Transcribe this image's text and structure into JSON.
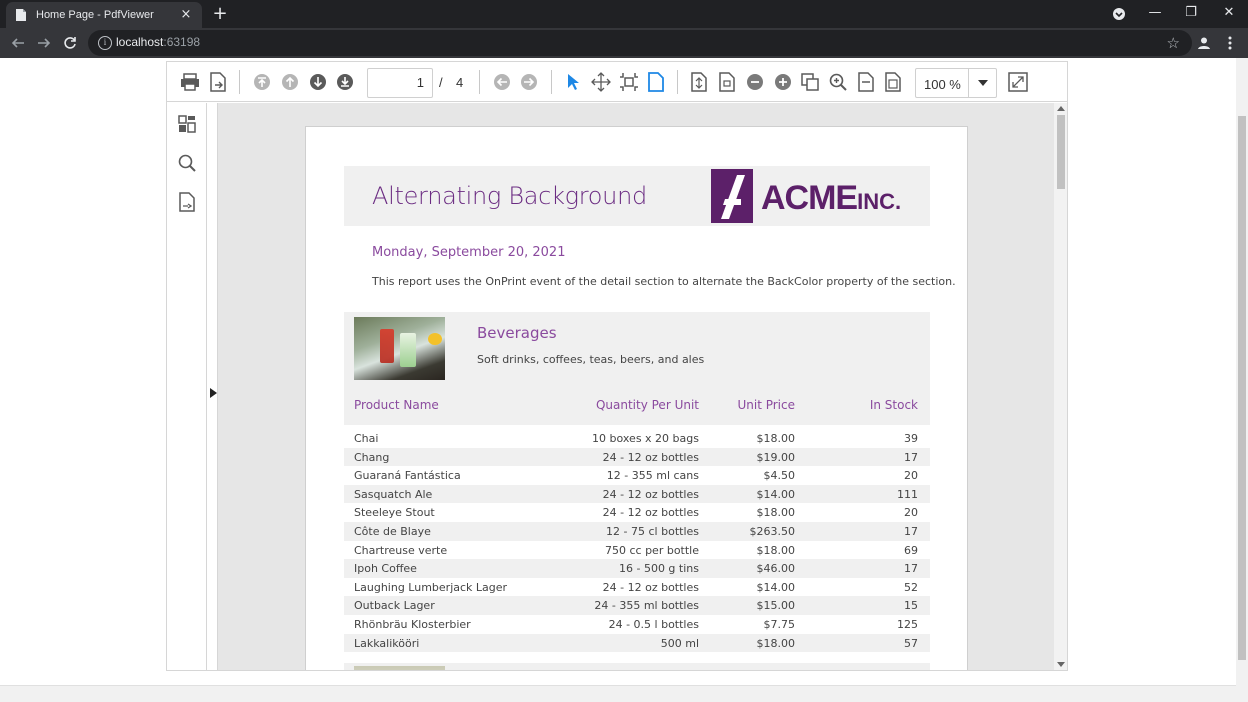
{
  "browser": {
    "tab_title": "Home Page - PdfViewer",
    "tab_close": "×",
    "new_tab": "+",
    "url_host": "localhost",
    "url_port": ":63198",
    "win_minimize": "—",
    "win_restore": "❐",
    "win_close": "✕"
  },
  "toolbar": {
    "page_current": "1",
    "page_separator": "/",
    "page_total": "4",
    "zoom_value": "100 %"
  },
  "report": {
    "title": "Alternating Background",
    "logo_text": "ACME",
    "logo_suffix": "INC.",
    "date": "Monday, September 20, 2021",
    "description": "This report uses the OnPrint event of the detail section to alternate the BackColor property of the section."
  },
  "category": {
    "name": "Beverages",
    "description": "Soft drinks, coffees, teas, beers, and ales",
    "columns": {
      "product": "Product Name",
      "quantity": "Quantity Per Unit",
      "price": "Unit Price",
      "stock": "In Stock"
    },
    "products": [
      {
        "name": "Chai",
        "qty": "10 boxes x 20 bags",
        "price": "$18.00",
        "stock": "39"
      },
      {
        "name": "Chang",
        "qty": "24 - 12 oz bottles",
        "price": "$19.00",
        "stock": "17"
      },
      {
        "name": "Guaraná Fantástica",
        "qty": "12 - 355 ml cans",
        "price": "$4.50",
        "stock": "20"
      },
      {
        "name": "Sasquatch Ale",
        "qty": "24 - 12 oz bottles",
        "price": "$14.00",
        "stock": "111"
      },
      {
        "name": "Steeleye Stout",
        "qty": "24 - 12 oz bottles",
        "price": "$18.00",
        "stock": "20"
      },
      {
        "name": "Côte de Blaye",
        "qty": "12 - 75 cl bottles",
        "price": "$263.50",
        "stock": "17"
      },
      {
        "name": "Chartreuse verte",
        "qty": "750 cc per bottle",
        "price": "$18.00",
        "stock": "69"
      },
      {
        "name": "Ipoh Coffee",
        "qty": "16 - 500 g tins",
        "price": "$46.00",
        "stock": "17"
      },
      {
        "name": "Laughing Lumberjack Lager",
        "qty": "24 - 12 oz bottles",
        "price": "$14.00",
        "stock": "52"
      },
      {
        "name": "Outback Lager",
        "qty": "24 - 355 ml bottles",
        "price": "$15.00",
        "stock": "15"
      },
      {
        "name": "Rhönbräu Klosterbier",
        "qty": "24 - 0.5 l bottles",
        "price": "$7.75",
        "stock": "125"
      },
      {
        "name": "Lakkalikööri",
        "qty": "500 ml",
        "price": "$18.00",
        "stock": "57"
      }
    ]
  },
  "colors": {
    "accent": "#6b2c82",
    "chrome_dark": "#202124",
    "chrome_bar": "#35363a",
    "toolbar_icon": "#5a5a5a",
    "toolbar_icon_active": "#1e88e5",
    "toolbar_icon_disabled": "#b5b5b5"
  }
}
